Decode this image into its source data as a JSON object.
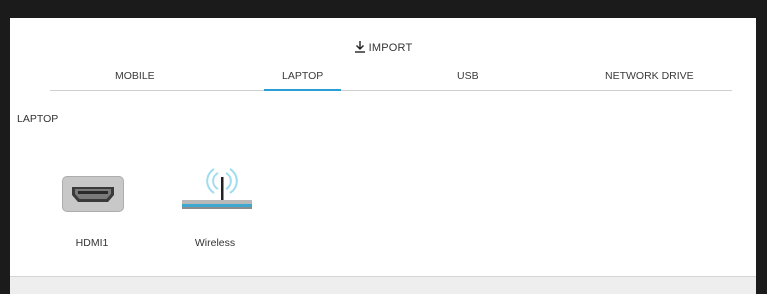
{
  "header": {
    "import_label": "IMPORT",
    "import_icon": "download-icon"
  },
  "tabs": [
    {
      "label": "MOBILE"
    },
    {
      "label": "LAPTOP",
      "active": true
    },
    {
      "label": "USB"
    },
    {
      "label": "NETWORK DRIVE"
    }
  ],
  "section": {
    "title": "LAPTOP"
  },
  "devices": [
    {
      "label": "HDMI1",
      "icon": "hdmi-port-icon"
    },
    {
      "label": "Wireless",
      "icon": "wireless-router-icon"
    }
  ],
  "colors": {
    "accent": "#2a9fd6",
    "background": "#1b1b1b",
    "panel": "#ffffff"
  }
}
